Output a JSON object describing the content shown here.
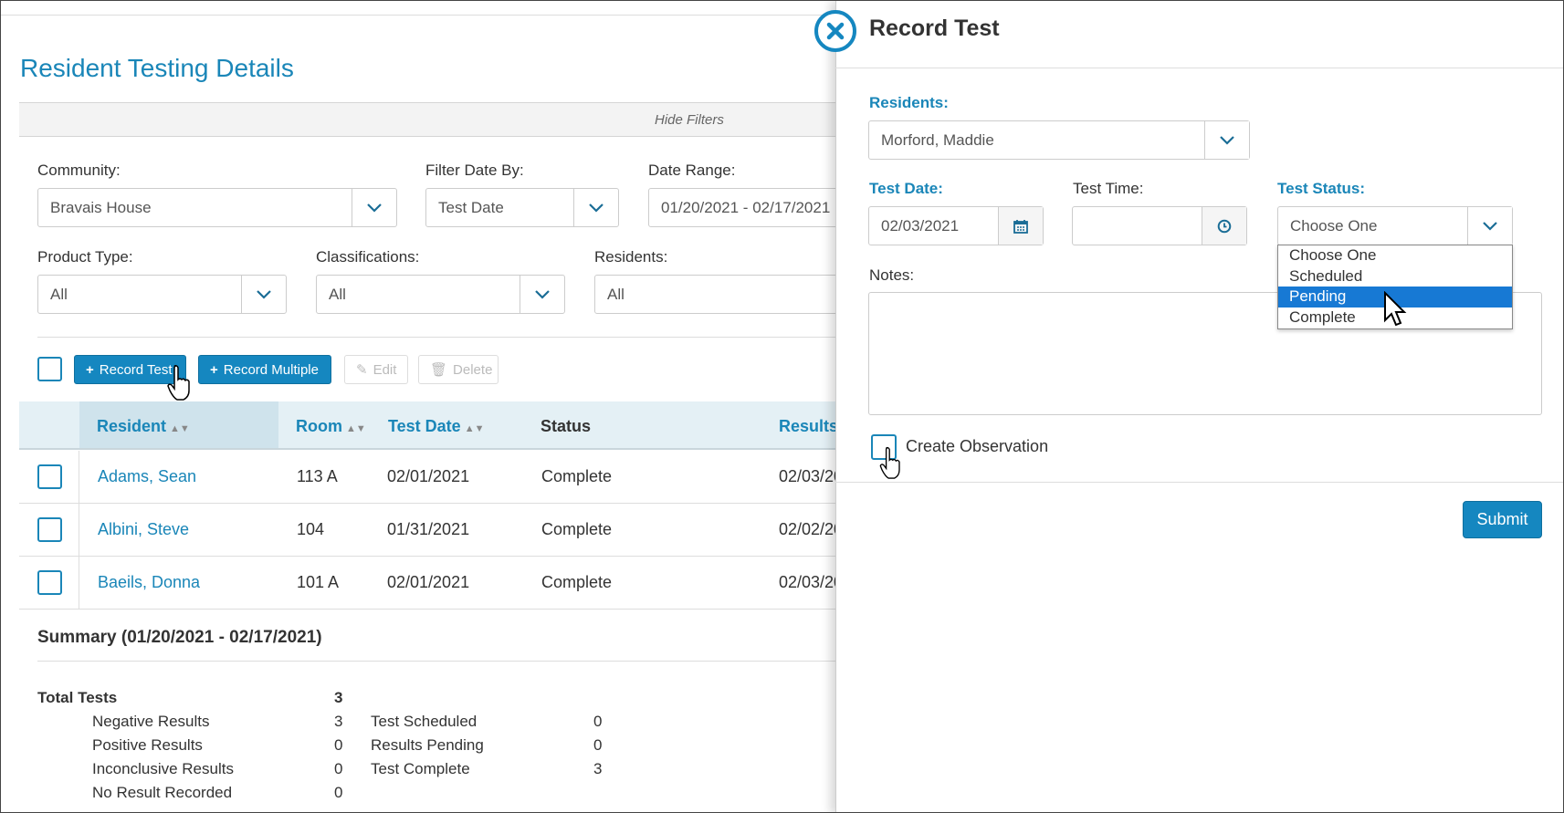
{
  "page": {
    "title": "Resident Testing Details",
    "hide_filters": "Hide Filters"
  },
  "filters": {
    "community": {
      "label": "Community:",
      "value": "Bravais House"
    },
    "filter_date_by": {
      "label": "Filter Date By:",
      "value": "Test Date"
    },
    "date_range": {
      "label": "Date Range:",
      "value": "01/20/2021 - 02/17/2021"
    },
    "product_type": {
      "label": "Product Type:",
      "value": "All"
    },
    "classifications": {
      "label": "Classifications:",
      "value": "All"
    },
    "residents": {
      "label": "Residents:",
      "value": "All"
    }
  },
  "toolbar": {
    "record_test": "Record Test",
    "record_multiple": "Record Multiple",
    "edit": "Edit",
    "delete": "Delete"
  },
  "table": {
    "columns": [
      "Resident",
      "Room",
      "Test Date",
      "Status",
      "Results"
    ],
    "rows": [
      {
        "resident": "Adams, Sean",
        "room": "113 A",
        "test_date": "02/01/2021",
        "status": "Complete",
        "results": "02/03/20"
      },
      {
        "resident": "Albini, Steve",
        "room": "104",
        "test_date": "01/31/2021",
        "status": "Complete",
        "results": "02/02/20"
      },
      {
        "resident": "Baeils, Donna",
        "room": "101 A",
        "test_date": "02/01/2021",
        "status": "Complete",
        "results": "02/03/20"
      }
    ]
  },
  "summary": {
    "title": "Summary (01/20/2021 - 02/17/2021)",
    "total_label": "Total Tests",
    "total_value": "3",
    "left": [
      {
        "label": "Negative Results",
        "value": "3"
      },
      {
        "label": "Positive Results",
        "value": "0"
      },
      {
        "label": "Inconclusive Results",
        "value": "0"
      },
      {
        "label": "No Result Recorded",
        "value": "0"
      }
    ],
    "right": [
      {
        "label": "Test Scheduled",
        "value": "0"
      },
      {
        "label": "Results Pending",
        "value": "0"
      },
      {
        "label": "Test Complete",
        "value": "3"
      }
    ]
  },
  "panel": {
    "title": "Record Test",
    "residents_label": "Residents:",
    "residents_value": "Morford, Maddie",
    "test_date_label": "Test Date:",
    "test_date_value": "02/03/2021",
    "test_time_label": "Test Time:",
    "test_time_value": "",
    "test_status_label": "Test Status:",
    "test_status_value": "Choose One",
    "status_options": [
      "Choose One",
      "Scheduled",
      "Pending",
      "Complete"
    ],
    "status_highlighted": "Pending",
    "notes_label": "Notes:",
    "create_observation": "Create Observation",
    "submit": "Submit"
  },
  "colors": {
    "accent": "#1587c0",
    "link": "#1a86b8",
    "highlight": "#1779d4"
  }
}
